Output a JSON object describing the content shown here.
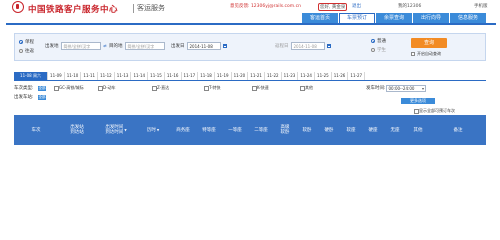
{
  "header": {
    "brand": "中国铁路客户服务中心",
    "subtitle": "客运服务",
    "welcome": "意见反馈: 12306yj@rails.com.cn",
    "user": "您好, 黄金泉",
    "logout": "退出",
    "my12306": "我的12306",
    "mobile": "手机版"
  },
  "nav": {
    "tabs": [
      "客运首页",
      "车票预订",
      "余票查询",
      "出行向导",
      "信息服务"
    ],
    "active_index": 1
  },
  "search": {
    "trip_types": [
      "单程",
      "往返"
    ],
    "from_label": "出发地",
    "from_placeholder": "简拼/全拼/汉字",
    "to_label": "目的地",
    "to_placeholder": "简拼/全拼/汉字",
    "depart_label": "出发日",
    "depart_date": "2014-11-08",
    "return_label": "返程日",
    "return_date": "2014-11-08",
    "passenger_types": [
      "普通",
      "学生"
    ],
    "query_button": "查询",
    "auto_query": "开启自动查询"
  },
  "dates": {
    "selected": "11-08 周六",
    "items": [
      "11-09",
      "11-10",
      "11-11",
      "11-12",
      "11-13",
      "11-14",
      "11-15",
      "11-16",
      "11-17",
      "11-18",
      "11-19",
      "11-20",
      "11-21",
      "11-22",
      "11-23",
      "11-24",
      "11-25",
      "11-26",
      "11-27"
    ]
  },
  "filters": {
    "train_type_label": "车次类型:",
    "all_label": "全部",
    "train_types": [
      "GC-高铁/城际",
      "D-动车",
      "Z-直达",
      "T-特快",
      "K-快速",
      "其他"
    ],
    "depart_time_label": "发车时间:",
    "depart_time_value": "00:00--24:00",
    "station_label": "出发车站:",
    "more_label": "更多选项",
    "show_all": "显示全部可预订车次"
  },
  "table": {
    "headers": [
      "车次",
      "出发站\n到达站",
      "出发时间\n到达时间",
      "历时",
      "商务座",
      "特等座",
      "一等座",
      "二等座",
      "高级\n软卧",
      "软卧",
      "硬卧",
      "软座",
      "硬座",
      "无座",
      "其他",
      "备注"
    ]
  },
  "colors": {
    "brand_red": "#c9242b",
    "primary_blue": "#2b6bc4",
    "query_orange": "#f28b24"
  }
}
